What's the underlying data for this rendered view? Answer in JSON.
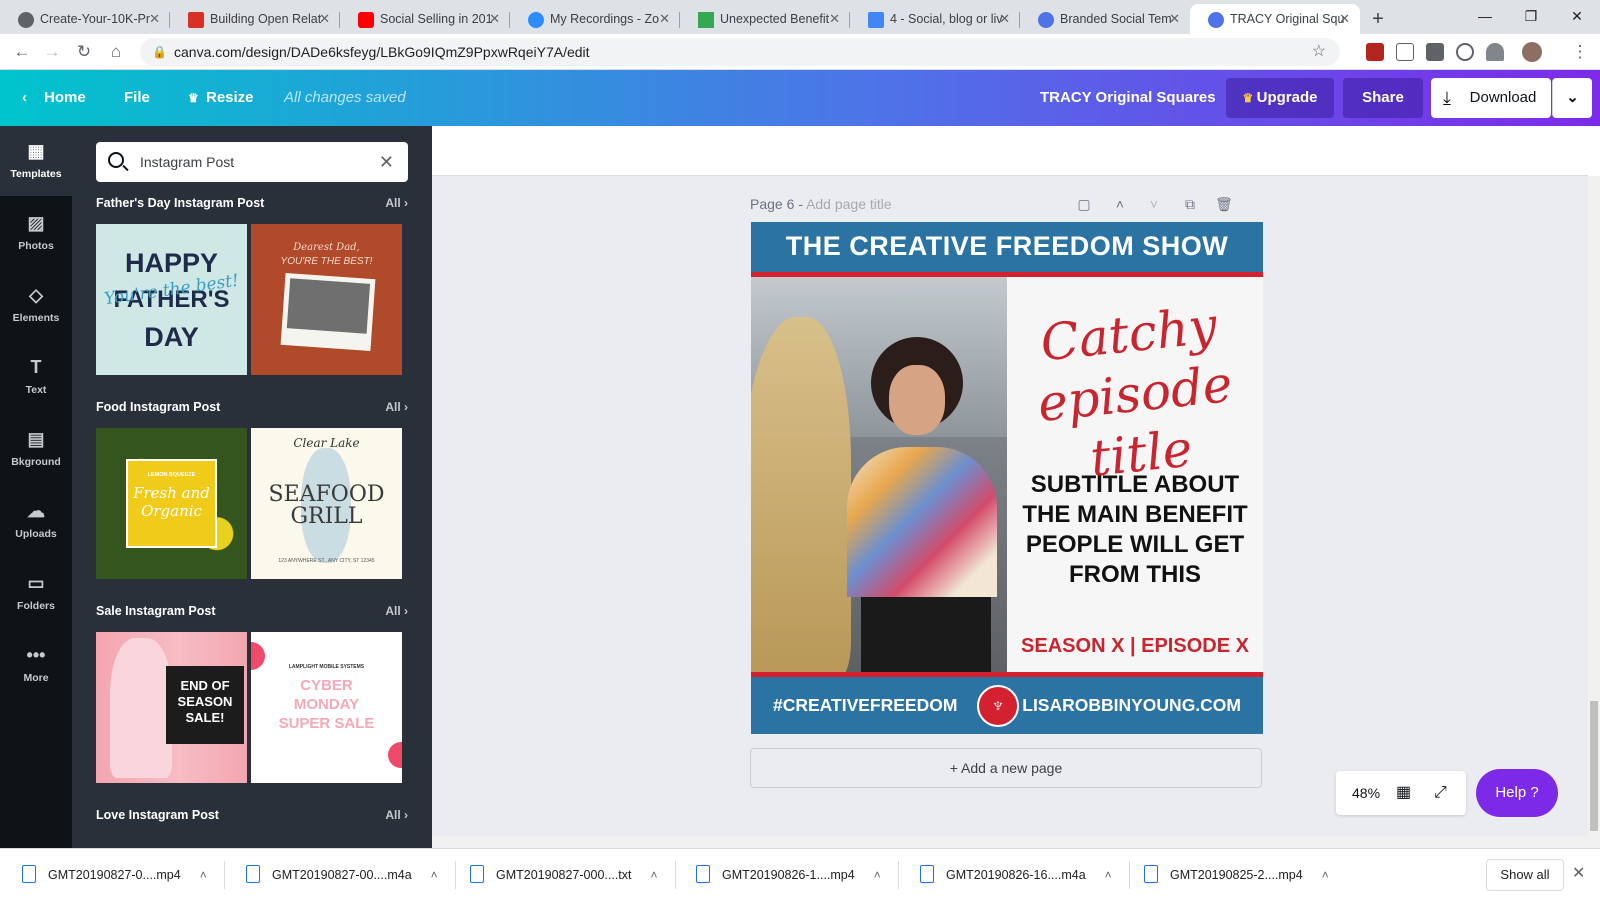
{
  "browser": {
    "tabs": [
      {
        "title": "Create-Your-10K-Pr",
        "color": "#5f6368"
      },
      {
        "title": "Building Open Relat",
        "color": "#d93025"
      },
      {
        "title": "Social Selling in 201",
        "color": "#ff0000"
      },
      {
        "title": "My Recordings - Zo",
        "color": "#2d8cff"
      },
      {
        "title": "Unexpected Benefit",
        "color": "#34a853"
      },
      {
        "title": "4 - Social, blog or liv",
        "color": "#4285f4"
      },
      {
        "title": "Branded Social Tem",
        "color": "#4e73e8"
      },
      {
        "title": "TRACY Original Squ",
        "color": "#4e73e8"
      }
    ],
    "url": "canva.com/design/DADe6ksfeyg/LBkGo9IQmZ9PpxwRqeiY7A/edit"
  },
  "canva_bar": {
    "home": "Home",
    "file": "File",
    "resize": "Resize",
    "saved": "All changes saved",
    "design_title": "TRACY Original Squares",
    "upgrade": "Upgrade",
    "share": "Share",
    "download": "Download"
  },
  "rail": [
    {
      "label": "Templates",
      "icon": "▦"
    },
    {
      "label": "Photos",
      "icon": "▨"
    },
    {
      "label": "Elements",
      "icon": "◇"
    },
    {
      "label": "Text",
      "icon": "T"
    },
    {
      "label": "Bkground",
      "icon": "▤"
    },
    {
      "label": "Uploads",
      "icon": "☁"
    },
    {
      "label": "Folders",
      "icon": "▭"
    },
    {
      "label": "More",
      "icon": "•••"
    }
  ],
  "panel": {
    "search_value": "Instagram Post",
    "all_label": "All",
    "sections": [
      {
        "title": "Father's Day Instagram Post"
      },
      {
        "title": "Food Instagram Post"
      },
      {
        "title": "Sale Instagram Post"
      },
      {
        "title": "Love Instagram Post"
      }
    ],
    "thumbs": {
      "fathers1_a": "HAPPY",
      "fathers1_b": "FATHER'S",
      "fathers1_c": "DAY",
      "fathers1_script": "You're the best!",
      "fathers2_a": "Dearest Dad,",
      "fathers2_b": "YOU'RE THE BEST!",
      "food1_a": "LEMON SQUEEZE",
      "food1_b": "Fresh and Organic",
      "food2_a": "Clear Lake",
      "food2_b": "SEAFOOD",
      "food2_c": "GRILL",
      "food2_d": "123 ANYWHERE ST., ANY CITY, ST 12345",
      "sale1": "END OF SEASON SALE!",
      "sale2_a": "LAMPLIGHT MOBILE SYSTEMS",
      "sale2_b": "CYBER MONDAY SUPER SALE"
    }
  },
  "canvas": {
    "page_label": "Page 6 -",
    "page_title_placeholder": "Add page title",
    "add_page": "+ Add a new page",
    "zoom": "48%",
    "help": "Help ?"
  },
  "design": {
    "top_title": "THE CREATIVE FREEDOM SHOW",
    "catchy": "Catchy episode title",
    "subtitle": "SUBTITLE ABOUT THE MAIN BENEFIT PEOPLE WILL GET FROM THIS",
    "season": "SEASON X | EPISODE X",
    "hashtag": "#CREATIVEFREEDOM",
    "website": "LISAROBBINYOUNG.COM",
    "blue": "#2a73a3",
    "red": "#d42130"
  },
  "downloads": {
    "items": [
      "GMT20190827-0....mp4",
      "GMT20190827-00....m4a",
      "GMT20190827-000....txt",
      "GMT20190826-1....mp4",
      "GMT20190826-16....m4a",
      "GMT20190825-2....mp4"
    ],
    "show_all": "Show all"
  }
}
